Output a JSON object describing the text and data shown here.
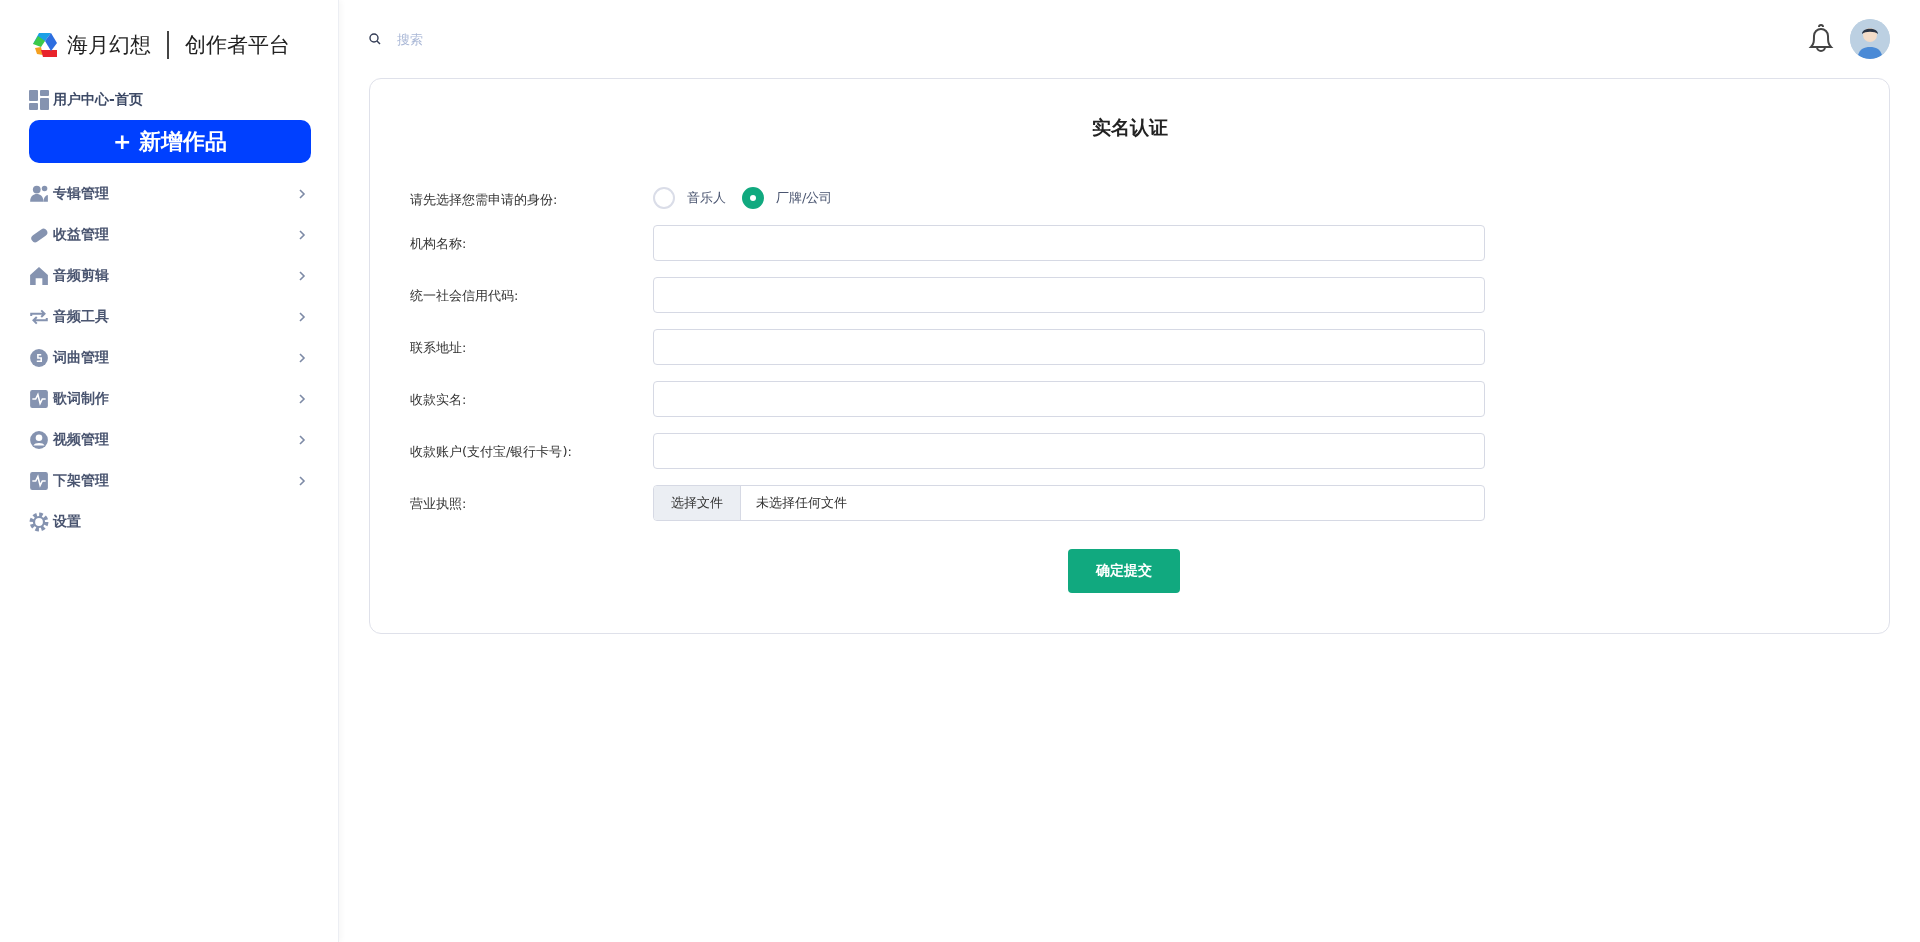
{
  "brand": {
    "name": "海月幻想",
    "platform": "创作者平台"
  },
  "sidebar": {
    "home": "用户中心-首页",
    "new_button": "+ 新增作品",
    "items": [
      {
        "label": "专辑管理",
        "kind": "submenu"
      },
      {
        "label": "收益管理",
        "kind": "submenu"
      },
      {
        "label": "音频剪辑",
        "kind": "submenu"
      },
      {
        "label": "音频工具",
        "kind": "submenu"
      },
      {
        "label": "词曲管理",
        "kind": "submenu"
      },
      {
        "label": "歌词制作",
        "kind": "submenu"
      },
      {
        "label": "视频管理",
        "kind": "submenu"
      },
      {
        "label": "下架管理",
        "kind": "submenu"
      },
      {
        "label": "设置",
        "kind": "link"
      }
    ]
  },
  "search": {
    "placeholder": "搜索"
  },
  "form": {
    "title": "实名认证",
    "identity": {
      "label": "请先选择您需申请的身份:",
      "options": [
        {
          "label": "音乐人",
          "selected": false
        },
        {
          "label": "厂牌/公司",
          "selected": true
        }
      ]
    },
    "fields": [
      {
        "label": "机构名称:",
        "kind": "text"
      },
      {
        "label": "统一社会信用代码:",
        "kind": "text"
      },
      {
        "label": "联系地址:",
        "kind": "text"
      },
      {
        "label": "收款实名:",
        "kind": "text"
      },
      {
        "label": "收款账户(支付宝/银行卡号):",
        "kind": "text"
      },
      {
        "label": "营业执照:",
        "kind": "file",
        "button": "选择文件",
        "status": "未选择任何文件"
      }
    ],
    "submit": "确定提交"
  }
}
